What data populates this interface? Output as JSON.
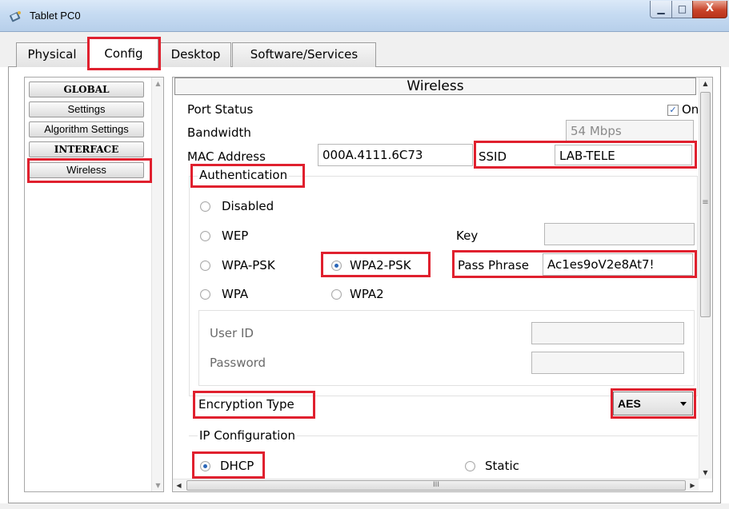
{
  "window": {
    "title": "Tablet PC0",
    "min_glyph": "▁",
    "max_glyph": "□",
    "close_glyph": "X"
  },
  "tabs": [
    {
      "label": "Physical"
    },
    {
      "label": "Config"
    },
    {
      "label": "Desktop"
    },
    {
      "label": "Software/Services"
    }
  ],
  "sidebar": {
    "global_header": "GLOBAL",
    "settings": "Settings",
    "algorithm_settings": "Algorithm Settings",
    "interface_header": "INTERFACE",
    "wireless": "Wireless"
  },
  "panel": {
    "title": "Wireless",
    "port_status_label": "Port Status",
    "port_status_value": "On",
    "bandwidth_label": "Bandwidth",
    "bandwidth_value": "54 Mbps",
    "mac_label": "MAC Address",
    "mac_value": "000A.4111.6C73",
    "ssid_label": "SSID",
    "ssid_value": "LAB-TELE",
    "auth_title": "Authentication",
    "auth_options": {
      "disabled": "Disabled",
      "wep": "WEP",
      "wpa_psk": "WPA-PSK",
      "wpa2_psk": "WPA2-PSK",
      "wpa": "WPA",
      "wpa2": "WPA2"
    },
    "auth_selected": "WPA2-PSK",
    "key_label": "Key",
    "key_value": "",
    "pass_phrase_label": "Pass Phrase",
    "pass_phrase_value": "Ac1es9oV2e8At7!",
    "user_id_label": "User ID",
    "password_label": "Password",
    "encryption_label": "Encryption Type",
    "encryption_value": "AES",
    "ip_config_title": "IP Configuration",
    "dhcp_label": "DHCP",
    "static_label": "Static",
    "ip_mode_selected": "DHCP"
  },
  "scroll": {
    "up": "▲",
    "down": "▼",
    "left": "◀",
    "right": "▶",
    "grip_h": "III",
    "grip_v": "≡"
  },
  "colors": {
    "highlight": "#e0202e",
    "radio_selected": "#2a66b8"
  }
}
